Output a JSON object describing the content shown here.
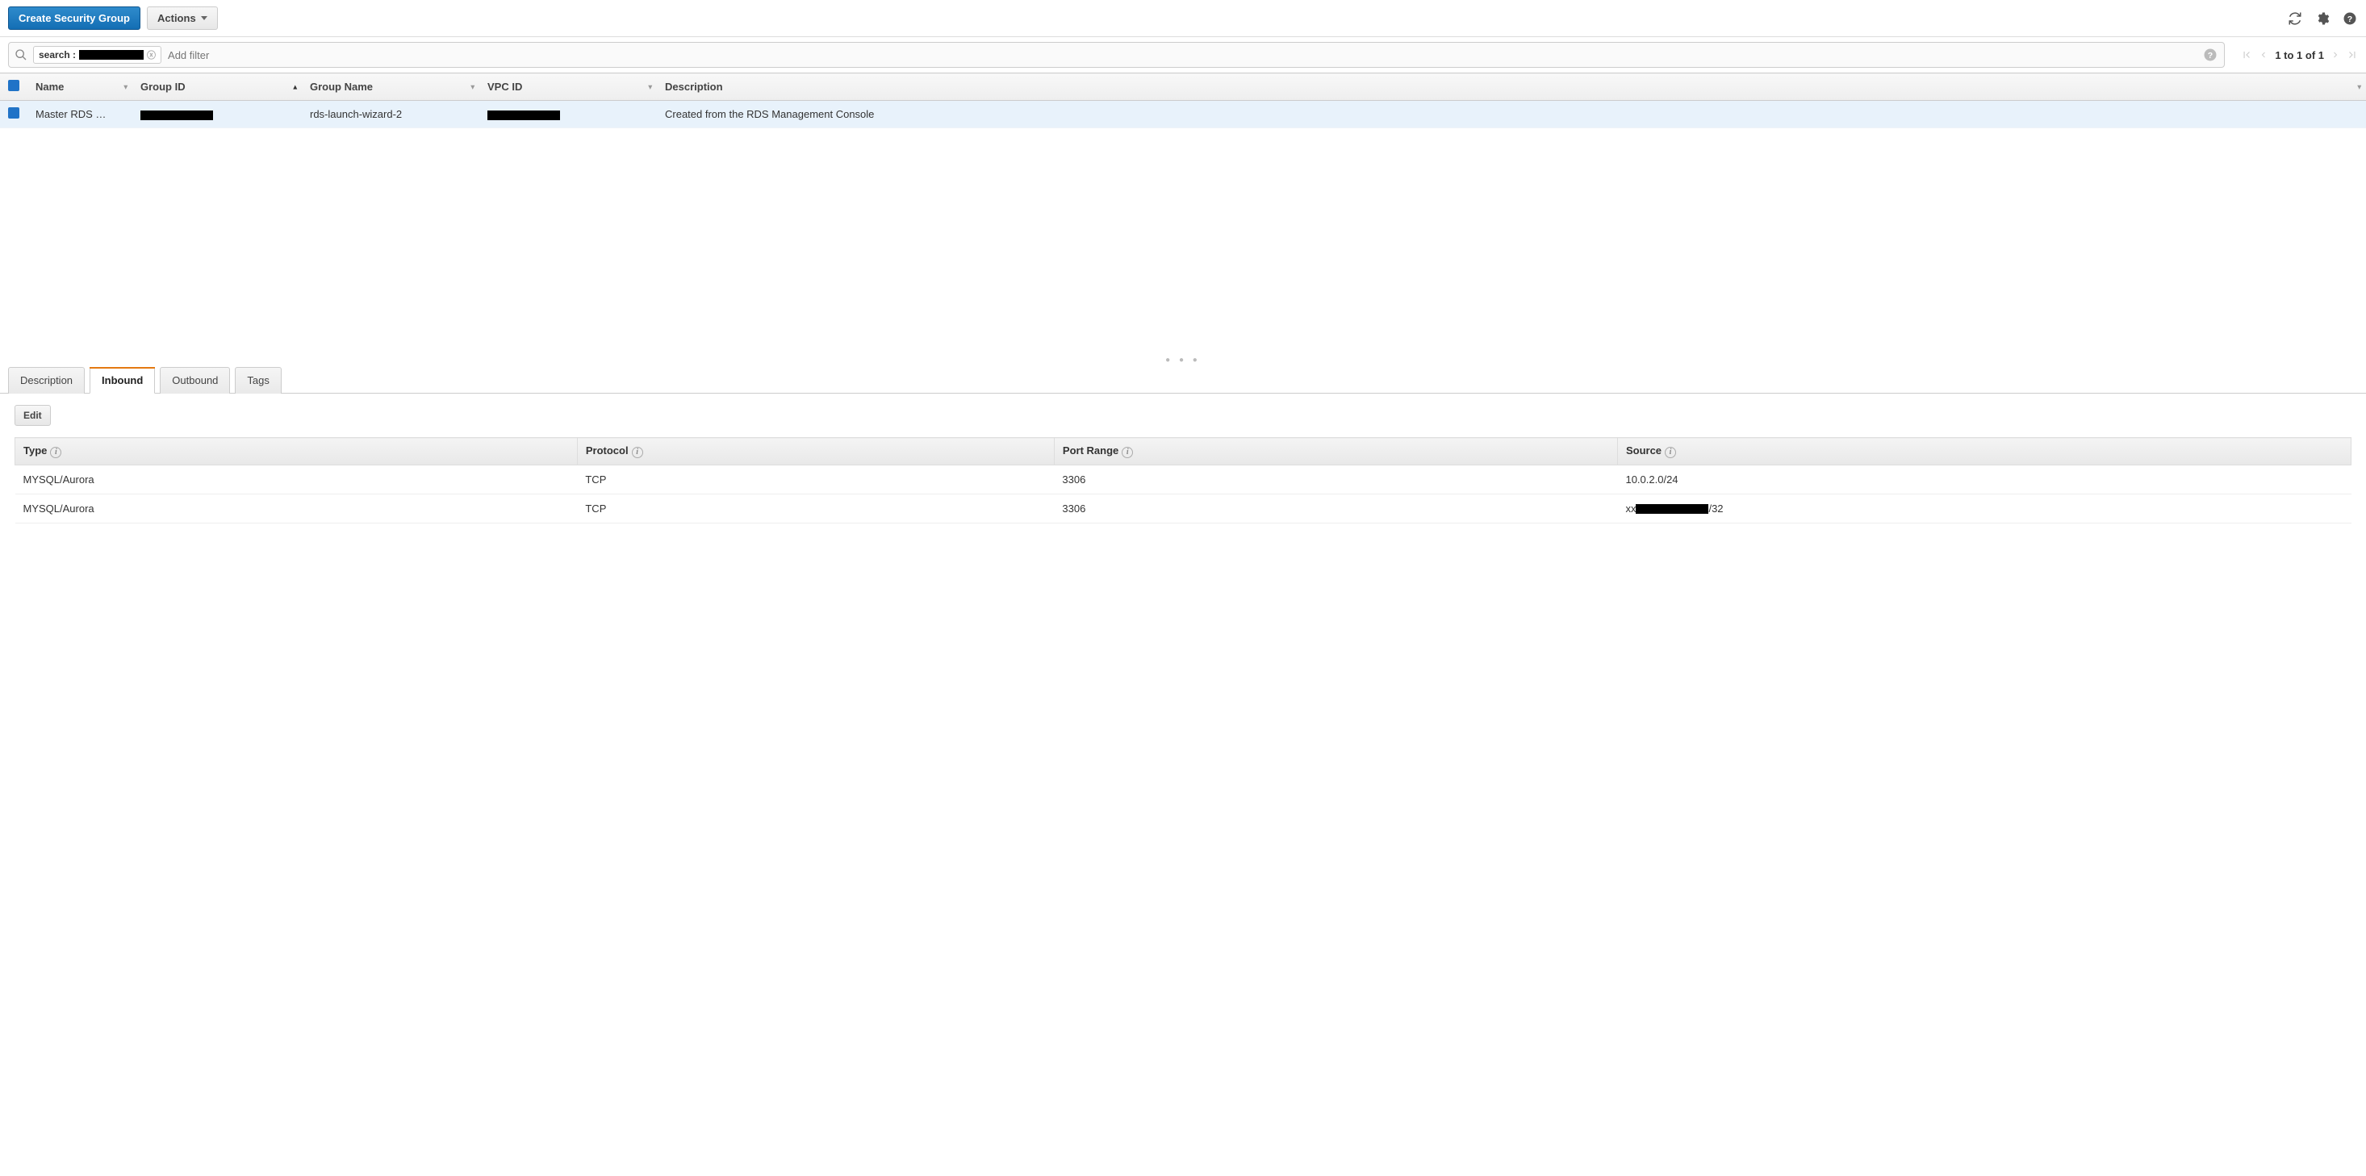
{
  "toolbar": {
    "create_label": "Create Security Group",
    "actions_label": "Actions"
  },
  "filter": {
    "chip_label": "search :",
    "chip_value_redacted": true,
    "placeholder": "Add filter"
  },
  "pager": {
    "text": "1 to 1 of 1"
  },
  "columns": {
    "checkbox": "",
    "name": "Name",
    "group_id": "Group ID",
    "group_name": "Group Name",
    "vpc_id": "VPC ID",
    "description": "Description"
  },
  "rows": [
    {
      "checked": true,
      "name": "Master RDS …",
      "group_id_redacted": true,
      "group_name": "rds-launch-wizard-2",
      "vpc_id_redacted": true,
      "description": "Created from the RDS Management Console"
    }
  ],
  "tabs": {
    "description": "Description",
    "inbound": "Inbound",
    "outbound": "Outbound",
    "tags": "Tags",
    "active": "inbound"
  },
  "inbound": {
    "edit_label": "Edit",
    "headers": {
      "type": "Type",
      "protocol": "Protocol",
      "port_range": "Port Range",
      "source": "Source"
    },
    "rules": [
      {
        "type": "MYSQL/Aurora",
        "protocol": "TCP",
        "port_range": "3306",
        "source": "10.0.2.0/24",
        "source_redacted": false
      },
      {
        "type": "MYSQL/Aurora",
        "protocol": "TCP",
        "port_range": "3306",
        "source_prefix": "xx",
        "source_suffix": "/32",
        "source_redacted": true
      }
    ]
  }
}
